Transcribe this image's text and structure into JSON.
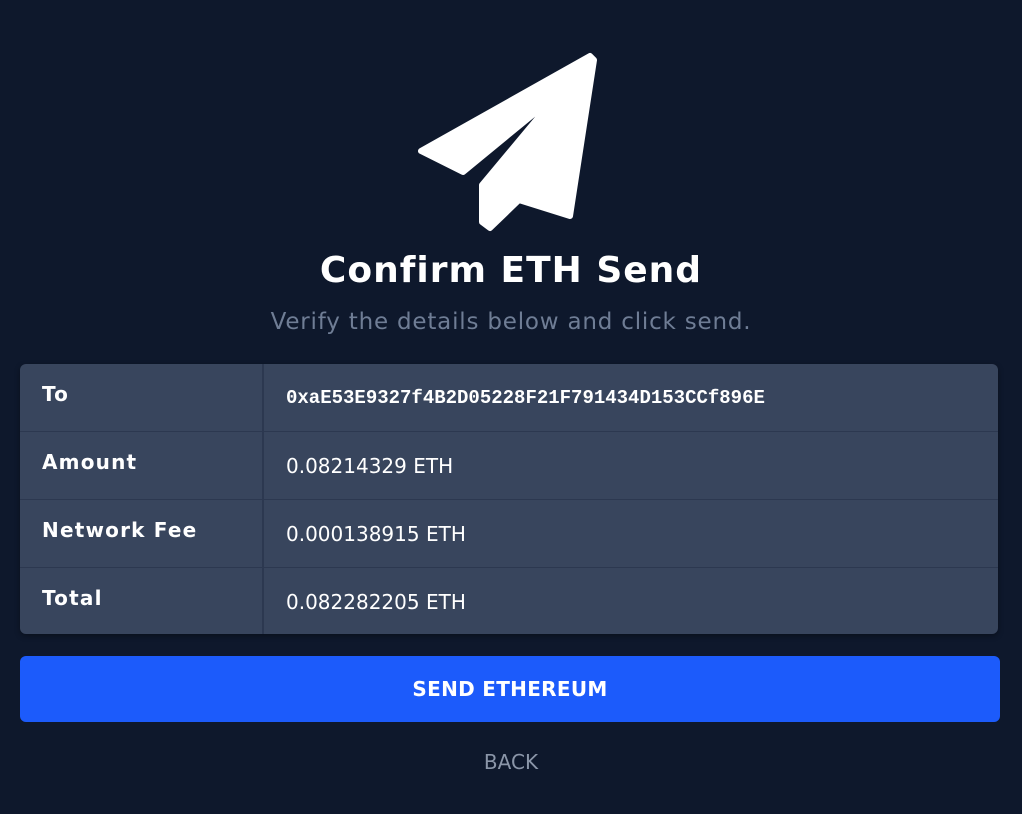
{
  "header": {
    "icon": "paper-plane-icon",
    "title": "Confirm ETH Send",
    "subtitle": "Verify the details below and click send."
  },
  "details": {
    "rows": [
      {
        "label": "To",
        "value": "0xaE53E9327f4B2D05228F21F791434D153CCf896E"
      },
      {
        "label": "Amount",
        "value": "0.08214329 ETH"
      },
      {
        "label": "Network Fee",
        "value": "0.000138915 ETH"
      },
      {
        "label": "Total",
        "value": "0.082282205 ETH"
      }
    ]
  },
  "actions": {
    "send_label": "SEND ETHEREUM",
    "back_label": "BACK"
  },
  "colors": {
    "background": "#0e182c",
    "card": "#38455d",
    "primary": "#1c5bfb",
    "muted_text": "#6f7d95"
  }
}
